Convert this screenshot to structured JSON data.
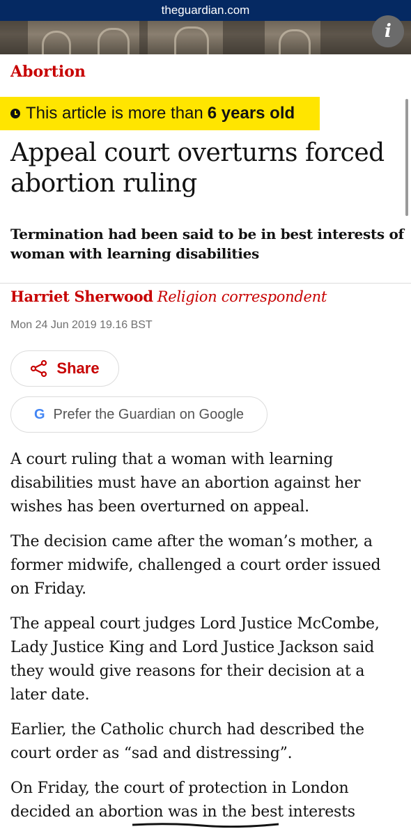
{
  "browser": {
    "url": "theguardian.com"
  },
  "header": {
    "info_icon": "i"
  },
  "article": {
    "section": "Abortion",
    "age_notice": {
      "prefix": "This article is more than",
      "age": "6 years old"
    },
    "headline": "Appeal court overturns forced abortion ruling",
    "standfirst": "Termination had been said to be in best interests of woman with learning disabilities",
    "byline": {
      "name": "Harriet Sherwood",
      "role": "Religion correspondent"
    },
    "date": "Mon 24 Jun 2019 19.16 BST",
    "share_label": "Share",
    "google_label": "Prefer the Guardian on Google",
    "paragraphs": [
      "A court ruling that a woman with learning disabilities must have an abortion against her wishes has been overturned on appeal.",
      "The decision came after the woman’s mother, a former midwife, challenged a court order issued on Friday.",
      "The appeal court judges Lord Justice McCombe, Lady Justice King and Lord Justice Jackson said they would give reasons for their decision at a later date.",
      "Earlier, the Catholic church had described the court order as “sad and distressing”.",
      "On Friday, the court of protection in London decided an abortion was in the best interests"
    ]
  },
  "colors": {
    "brand": "#052962",
    "accent": "#c70000",
    "banner": "#ffe500"
  },
  "icons": [
    "clock-icon",
    "share-icon",
    "google-g-icon",
    "info-icon"
  ]
}
